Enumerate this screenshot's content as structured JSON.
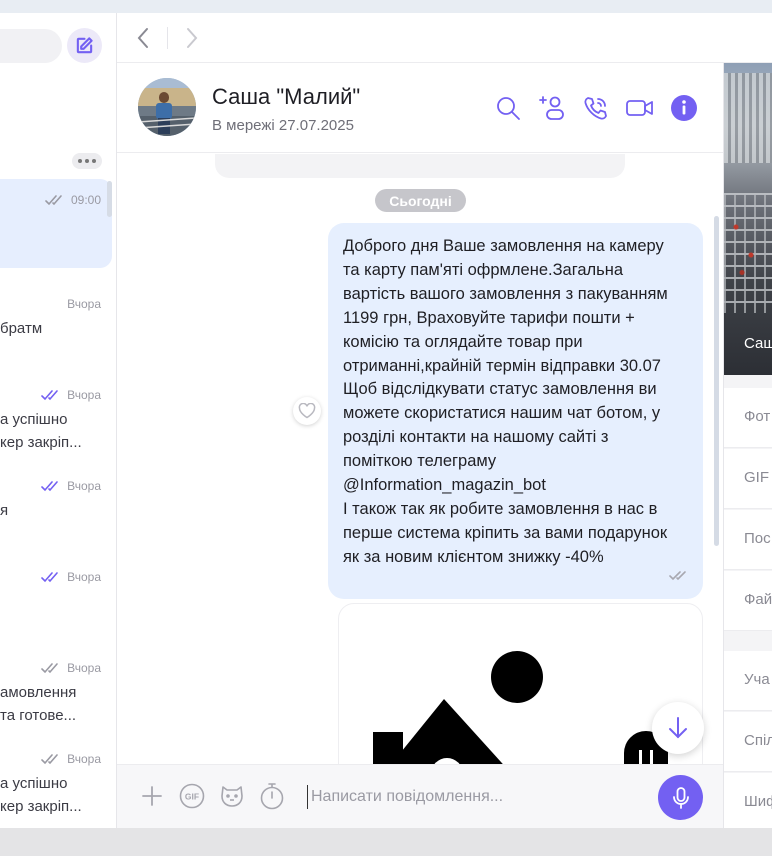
{
  "chat_list": {
    "active_time": "09:00",
    "rows": [
      {
        "time": "Вчора",
        "lines": [
          "братм"
        ],
        "read": false
      },
      {
        "time": "Вчора",
        "lines": [
          "а успішно",
          "кер закріп..."
        ],
        "read": true
      },
      {
        "time": "Вчора",
        "lines": [
          "я"
        ],
        "read": true
      },
      {
        "time": "Вчора",
        "lines": [],
        "read": true
      },
      {
        "time": "Вчора",
        "lines": [
          "амовлення",
          " та готове..."
        ],
        "read": false
      },
      {
        "time": "Вчора",
        "lines": [
          "а успішно",
          "кер закріп..."
        ],
        "read": false
      }
    ]
  },
  "header": {
    "name": "Саша \"Малий\"",
    "status": "В мережі 27.07.2025"
  },
  "messages": {
    "date_separator": "Сьогодні",
    "text": "Доброго дня Ваше замовлення на камеру\nта карту пам'яті офрмлене.Загальна\nвартість вашого замовлення з пакуванням\n1199 грн, Враховуйте тарифи пошти +\nкомісію  та оглядайте товар при\nотриманні,крайній термін відправки 30.07\nЩоб відслідкувати статус замовлення ви\nможете скористатися нашим чат ботом, у\nрозділі контакти на нашому сайті з\nпоміткою телеграму\n@Information_magazin_bot\nІ також так як робите замовлення в нас в\nперше система кріпить за вами подарунок\nяк за новим клієнтом знижку -40%"
  },
  "input": {
    "placeholder": "Написати повідомлення..."
  },
  "info_panel": {
    "cover_label": "Саш",
    "items": [
      "Фот",
      "GIF",
      "Пос",
      "Фай",
      "Уча",
      "Спіл",
      "Шиф"
    ]
  },
  "colors": {
    "accent": "#7360f2",
    "bubble": "#e6effe",
    "active_chat": "#e6eefe"
  }
}
